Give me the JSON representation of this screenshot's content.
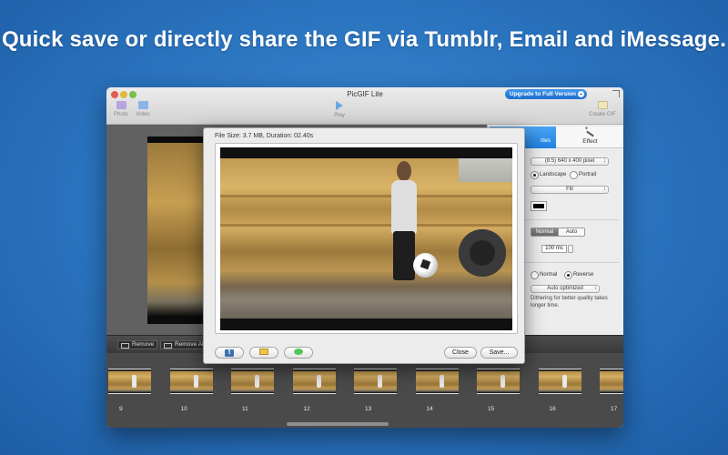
{
  "headline": "Quick save or directly share the GIF via Tumblr, Email and iMessage.",
  "window": {
    "title": "PicGIF Lite",
    "upgrade_label": "Upgrade to Full Version"
  },
  "toolbar": {
    "photo_label": "Photo",
    "video_label": "Video",
    "play_label": "Play",
    "create_label": "Create GIF"
  },
  "properties": {
    "tab_properties": "rties",
    "tab_effect": "Effect",
    "size_value": "(8:5) 640 x 400 pixel",
    "orient_landscape": "Landscape",
    "orient_portrait": "Portrait",
    "fill_value": "Fill",
    "bg_color": "#000000",
    "mode_normal": "Normal",
    "mode_auto": "Auto",
    "speed_value": "100 ms",
    "dir_normal": "Normal",
    "dir_reverse": "Reverse",
    "quality_value": "Auto optimized",
    "dither_note": "Dithering for better quality takes longer time."
  },
  "frames_toolbar": {
    "remove_label": "Remove",
    "remove_all_label": "Remove Al"
  },
  "frames": [
    "9",
    "10",
    "11",
    "12",
    "13",
    "14",
    "15",
    "16",
    "17"
  ],
  "dialog": {
    "file_info": "File Size: 3.7 MB, Duration: 02.40s",
    "tumblr_glyph": "t",
    "close_label": "Close",
    "save_label": "Save..."
  }
}
